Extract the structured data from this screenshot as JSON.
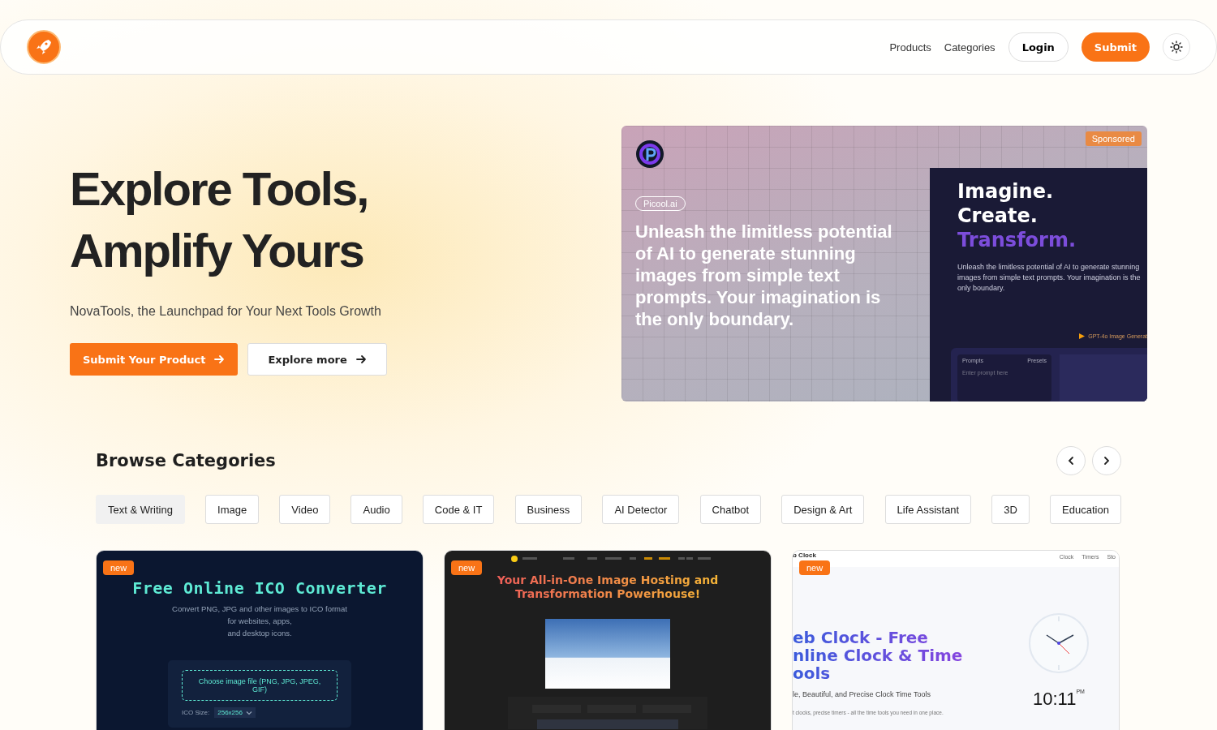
{
  "nav": {
    "links": [
      "Products",
      "Categories"
    ],
    "login": "Login",
    "submit": "Submit"
  },
  "hero": {
    "title_lines": [
      "Explore Tools,",
      "Amplify Yours"
    ],
    "subtitle": "NovaTools, the Launchpad for Your Next Tools Growth",
    "buttons": [
      {
        "label": "Submit Your Product",
        "kind": "primary"
      },
      {
        "label": "Explore more",
        "kind": "secondary"
      }
    ]
  },
  "sponsor": {
    "badge": "Sponsored",
    "tag": "Picool.ai",
    "headline": "Unleash the limitless potential of AI to generate stunning images from simple text prompts. Your imagination is the only boundary.",
    "preview": {
      "lines": [
        {
          "text": "Imagine.",
          "accent": false
        },
        {
          "text": "Create.",
          "accent": false
        },
        {
          "text": "Transform.",
          "accent": true
        }
      ],
      "description": "Unleash the limitless potential of AI to generate stunning images from simple text prompts. Your imagination is the only boundary.",
      "model": "GPT-4o Image Generat",
      "prompts_label": "Prompts",
      "presets": "Presets",
      "placeholder": "Enter prompt here"
    }
  },
  "categories": {
    "title": "Browse Categories",
    "items": [
      {
        "label": "Text & Writing",
        "selected": true
      },
      {
        "label": "Image",
        "selected": false
      },
      {
        "label": "Video",
        "selected": false
      },
      {
        "label": "Audio",
        "selected": false
      },
      {
        "label": "Code & IT",
        "selected": false
      },
      {
        "label": "Business",
        "selected": false
      },
      {
        "label": "AI Detector",
        "selected": false
      },
      {
        "label": "Chatbot",
        "selected": false
      },
      {
        "label": "Design & Art",
        "selected": false
      },
      {
        "label": "Life Assistant",
        "selected": false
      },
      {
        "label": "3D",
        "selected": false
      },
      {
        "label": "Education",
        "selected": false
      }
    ]
  },
  "products": [
    {
      "kind": "ico",
      "badge": "new",
      "title": "Free Online ICO Converter",
      "description_lines": [
        "Convert PNG, JPG and other images to ICO format",
        "for websites, apps,",
        "and desktop icons."
      ],
      "dropzone": "Choose image file (PNG, JPG, JPEG, GIF)",
      "size_label": "ICO Size:",
      "size_value": "256x256"
    },
    {
      "kind": "hosting",
      "badge": "new",
      "title": "Your All-in-One Image Hosting and Transformation Powerhouse!"
    },
    {
      "kind": "clock",
      "badge": "new",
      "brand": "b Clock",
      "nav": [
        "Clock",
        "Timers",
        "Sto"
      ],
      "title_lines": [
        "eb Clock - Free",
        "nline Clock & Time",
        "ools"
      ],
      "subtitle": "le, Beautiful, and Precise Clock Time Tools",
      "text": "t clocks, precise timers - all the time tools you need in one place.",
      "time": "10:11",
      "meridiem": "PM"
    }
  ]
}
